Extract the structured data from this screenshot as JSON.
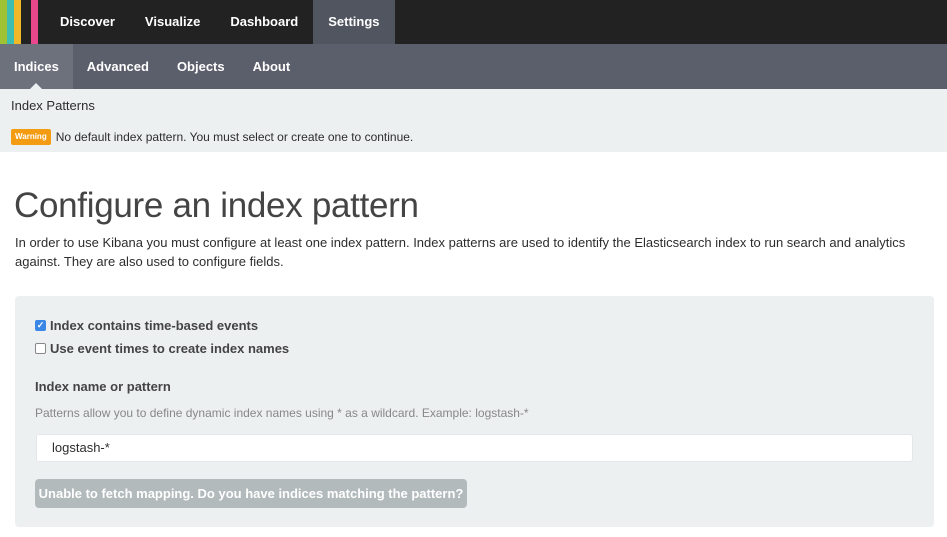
{
  "brand": {
    "stripes": [
      "#e8478b",
      "#3ebeb0",
      "#f3b72a",
      "#9ec233",
      "#e8478b"
    ]
  },
  "nav": {
    "items": [
      {
        "label": "Discover"
      },
      {
        "label": "Visualize"
      },
      {
        "label": "Dashboard"
      },
      {
        "label": "Settings",
        "active": true
      }
    ]
  },
  "subnav": {
    "items": [
      {
        "label": "Indices",
        "active": true
      },
      {
        "label": "Advanced"
      },
      {
        "label": "Objects"
      },
      {
        "label": "About"
      }
    ]
  },
  "breadcrumb": "Index Patterns",
  "warning": {
    "badge": "Warning",
    "text": "No default index pattern. You must select or create one to continue."
  },
  "page": {
    "title": "Configure an index pattern",
    "intro": "In order to use Kibana you must configure at least one index pattern. Index patterns are used to identify the Elasticsearch index to run search and analytics against. They are also used to configure fields."
  },
  "form": {
    "time_based": {
      "label": "Index contains time-based events",
      "checked": true
    },
    "event_times": {
      "label": "Use event times to create index names",
      "checked": false
    },
    "index_label": "Index name or pattern",
    "help": "Patterns allow you to define dynamic index names using * as a wildcard. Example: logstash-*",
    "index_value": "logstash-*",
    "submit_label": "Unable to fetch mapping. Do you have indices matching the pattern?"
  },
  "colors": {
    "topbar": "#222222",
    "subbar": "#5a5f6b",
    "panel": "#ecf0f1",
    "warning": "#f39c12",
    "checkbox": "#3b87e6",
    "disabled_button": "#b2babb"
  }
}
